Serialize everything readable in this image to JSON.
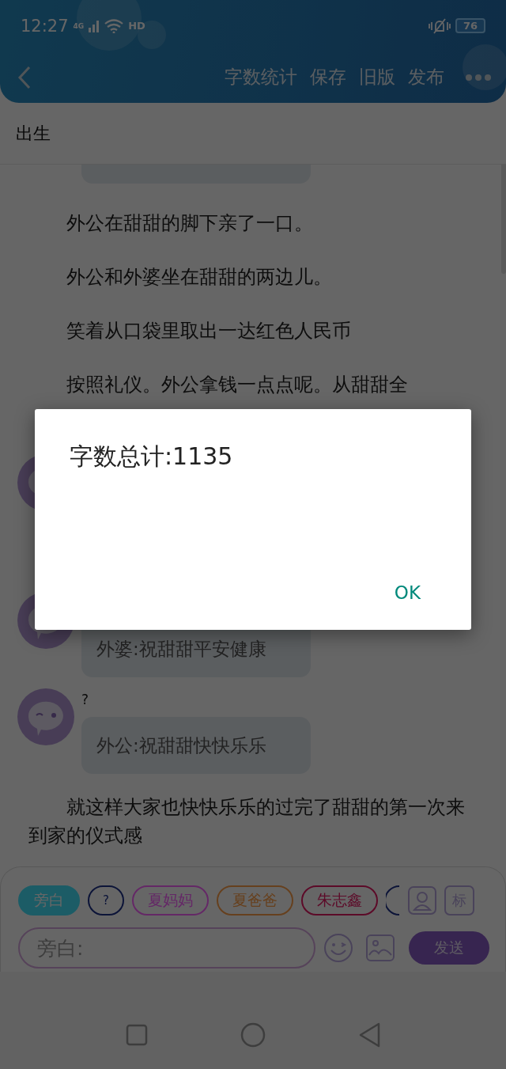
{
  "status_bar": {
    "time": "12:27",
    "network": "4G",
    "hd": "HD",
    "battery": "76"
  },
  "header": {
    "actions": [
      "字数统计",
      "保存",
      "旧版",
      "发布"
    ]
  },
  "page_title": "出生",
  "content": [
    {
      "kind": "bubble"
    },
    {
      "kind": "paragraph",
      "text": "外公在甜甜的脚下亲了一口。"
    },
    {
      "kind": "paragraph",
      "text": "外公和外婆坐在甜甜的两边儿。"
    },
    {
      "kind": "paragraph",
      "text": "笑着从口袋里取出一达红色人民币"
    },
    {
      "kind": "paragraph",
      "text": "按照礼仪。外公拿钱一点点呢。从甜甜全"
    },
    {
      "kind": "chat"
    },
    {
      "kind": "chat",
      "text": "外婆:祝甜甜平安健康"
    },
    {
      "kind": "chat",
      "speaker": "?",
      "text": "外公:祝甜甜快快乐乐"
    },
    {
      "kind": "paragraph",
      "text": "就这样大家也快快乐乐的过完了甜甜的第一次来到家的仪式感"
    }
  ],
  "roles": [
    {
      "kind": "chip",
      "label": "旁白",
      "color": "#1c5c66",
      "selected": true
    },
    {
      "kind": "chip",
      "label": "?",
      "color": "#0c1438",
      "selected": false
    },
    {
      "kind": "chip",
      "label": "夏妈妈",
      "color": "#64286a",
      "selected": false
    },
    {
      "kind": "chip",
      "label": "夏爸爸",
      "color": "#66401e",
      "selected": false
    },
    {
      "kind": "chip",
      "label": "朱志鑫",
      "color": "#5c0a28",
      "selected": false
    },
    {
      "kind": "cut",
      "color": "#0c1438",
      "selected": false
    }
  ],
  "tag_button": "标",
  "input": {
    "placeholder": "旁白:"
  },
  "send": "发送",
  "dialog": {
    "message": "字数总计:1135",
    "button": "OK"
  }
}
